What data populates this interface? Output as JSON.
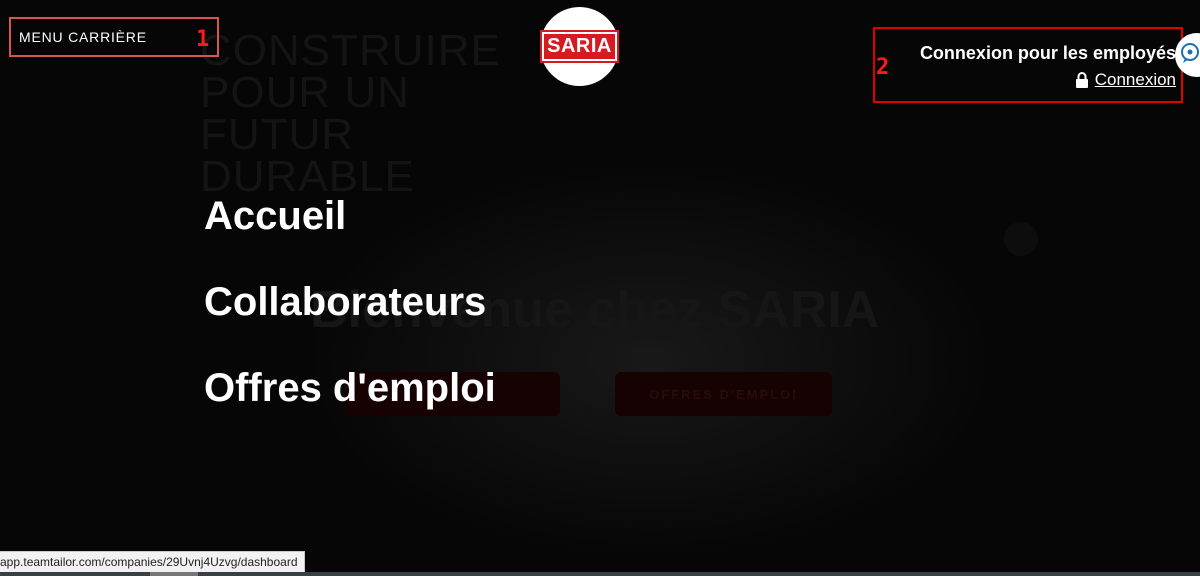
{
  "menu": {
    "label": "MENU CARRIÈRE"
  },
  "markers": {
    "first": "1",
    "second": "2"
  },
  "logo": {
    "text": "SARIA"
  },
  "background": {
    "heading": "CONSTRUIRE POUR UN FUTUR DURABLE",
    "welcome": "Bienvenue chez SARIA",
    "buttons": [
      "",
      "OFFRES D'EMPLOI"
    ]
  },
  "login": {
    "title": "Connexion pour les employés",
    "link_label": "Connexion"
  },
  "nav": {
    "items": [
      {
        "label": "Accueil"
      },
      {
        "label": "Collaborateurs"
      },
      {
        "label": "Offres d'emploi"
      }
    ]
  },
  "status": {
    "url": "app.teamtailor.com/companies/29Uvnj4Uzvg/dashboard"
  },
  "colors": {
    "background": "#060606",
    "marker_red": "#ff1a1a",
    "brand_red": "#d71920",
    "text": "#ffffff"
  },
  "icons": [
    "lock-icon",
    "chat-bubble-icon"
  ]
}
